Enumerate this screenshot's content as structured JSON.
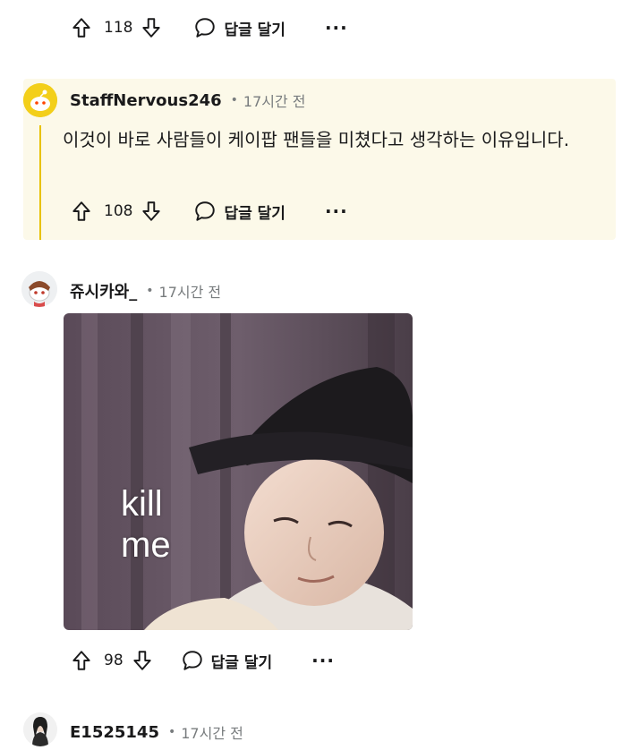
{
  "comments": [
    {
      "votes": "118",
      "reply_label": "답글 달기",
      "more": "···"
    },
    {
      "username": "StaffNervous246",
      "time": "17시간 전",
      "text": "이것이 바로 사람들이 케이팝 팬들을 미쳤다고 생각하는 이유입니다.",
      "votes": "108",
      "reply_label": "답글 달기",
      "more": "···",
      "highlight_color": "#fcf9e9",
      "thread_line_color": "#e8c200"
    },
    {
      "username": "쥬시카와_",
      "time": "17시간 전",
      "image_caption": "kill\nme",
      "votes": "98",
      "reply_label": "답글 달기",
      "more": "···"
    },
    {
      "username": "E1525145",
      "time": "17시간 전"
    }
  ],
  "separator": "•",
  "icons": [
    "upvote-icon",
    "downvote-icon",
    "comment-bubble-icon",
    "more-icon",
    "avatar-icon"
  ]
}
